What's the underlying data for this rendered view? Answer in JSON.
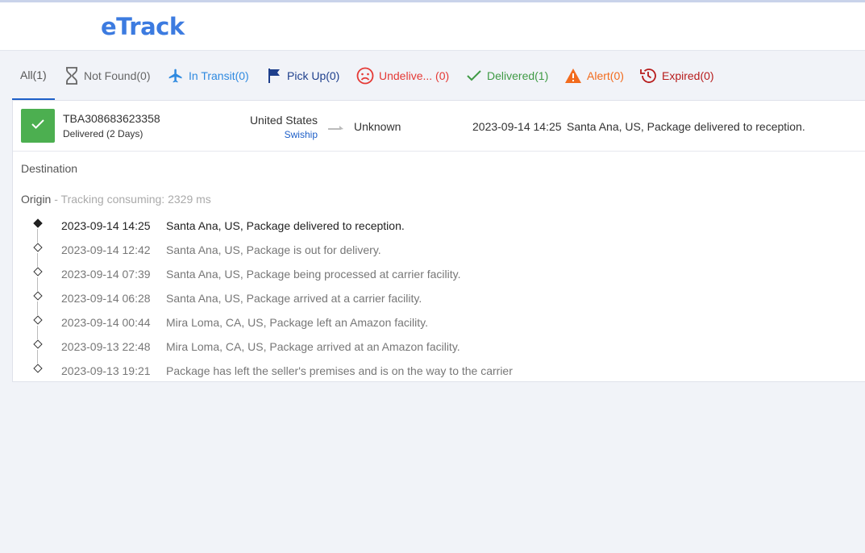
{
  "header": {
    "logo_e": "e",
    "logo_rest": "Track"
  },
  "tabs": [
    {
      "label": "All(1)",
      "color": "#555555",
      "icon": "none"
    },
    {
      "label": "Not Found(0)",
      "color": "#666666",
      "icon": "hourglass-icon"
    },
    {
      "label": "In Transit(0)",
      "color": "#2f8ae0",
      "icon": "airplane-icon"
    },
    {
      "label": "Pick Up(0)",
      "color": "#1e3f8c",
      "icon": "flag-icon"
    },
    {
      "label": "Undelive... (0)",
      "color": "#e53935",
      "icon": "sad-face-icon"
    },
    {
      "label": "Delivered(1)",
      "color": "#3f9a45",
      "icon": "check-icon"
    },
    {
      "label": "Alert(0)",
      "color": "#f26b1d",
      "icon": "warning-icon"
    },
    {
      "label": "Expired(0)",
      "color": "#b71c1c",
      "icon": "history-icon"
    }
  ],
  "shipment": {
    "tracking_number": "TBA308683623358",
    "status": "Delivered (2 Days)",
    "status_color": "#4caf50",
    "origin_country": "United States",
    "carrier": "Swiship",
    "destination_country": "Unknown",
    "latest_time": "2023-09-14 14:25",
    "latest_desc": "Santa Ana, US, Package delivered to reception."
  },
  "details": {
    "destination_label": "Destination",
    "origin_label": "Origin",
    "origin_meta": " - Tracking consuming: 2329 ms"
  },
  "events": [
    {
      "time": "2023-09-14 14:25",
      "desc": "Santa Ana, US, Package delivered to reception."
    },
    {
      "time": "2023-09-14 12:42",
      "desc": "Santa Ana, US, Package is out for delivery."
    },
    {
      "time": "2023-09-14 07:39",
      "desc": "Santa Ana, US, Package being processed at carrier facility."
    },
    {
      "time": "2023-09-14 06:28",
      "desc": "Santa Ana, US, Package arrived at a carrier facility."
    },
    {
      "time": "2023-09-14 00:44",
      "desc": "Mira Loma, CA, US, Package left an Amazon facility."
    },
    {
      "time": "2023-09-13 22:48",
      "desc": "Mira Loma, CA, US, Package arrived at an Amazon facility."
    },
    {
      "time": "2023-09-13 19:21",
      "desc": "Package has left the seller's premises and is on the way to the carrier"
    }
  ]
}
